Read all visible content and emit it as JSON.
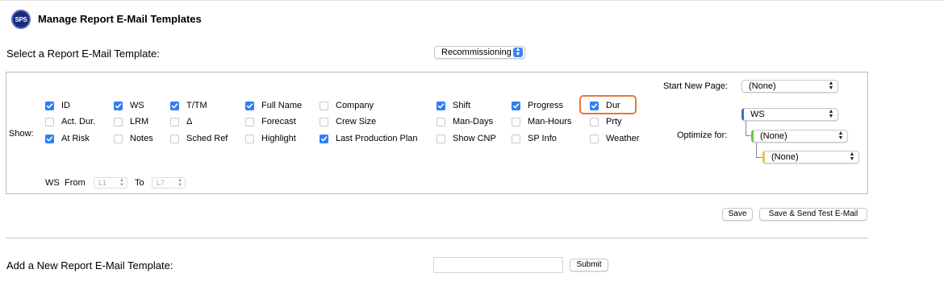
{
  "header": {
    "logo_text": "SPS",
    "title": "Manage Report E-Mail Templates"
  },
  "template_select": {
    "label": "Select a Report E-Mail Template:",
    "value": "Recommissioning"
  },
  "show": {
    "label": "Show:",
    "options": [
      [
        {
          "label": "ID",
          "checked": true
        },
        {
          "label": "Act. Dur.",
          "checked": false
        },
        {
          "label": "At Risk",
          "checked": true
        }
      ],
      [
        {
          "label": "WS",
          "checked": true
        },
        {
          "label": "LRM",
          "checked": false
        },
        {
          "label": "Notes",
          "checked": false
        }
      ],
      [
        {
          "label": "T/TM",
          "checked": true
        },
        {
          "label": "Δ",
          "checked": false
        },
        {
          "label": "Sched Ref",
          "checked": false
        }
      ],
      [
        {
          "label": "Full Name",
          "checked": true
        },
        {
          "label": "Forecast",
          "checked": false
        },
        {
          "label": "Highlight",
          "checked": false
        }
      ],
      [
        {
          "label": "Company",
          "checked": false
        },
        {
          "label": "Crew Size",
          "checked": false
        },
        {
          "label": "Last Production Plan",
          "checked": true
        }
      ],
      [
        {
          "label": "Shift",
          "checked": true
        },
        {
          "label": "Man-Days",
          "checked": false
        },
        {
          "label": "Show CNP",
          "checked": false
        }
      ],
      [
        {
          "label": "Progress",
          "checked": true
        },
        {
          "label": "Man-Hours",
          "checked": false
        },
        {
          "label": "SP Info",
          "checked": false
        }
      ],
      [
        {
          "label": "Dur",
          "checked": true
        },
        {
          "label": "Prty",
          "checked": false
        },
        {
          "label": "Weather",
          "checked": false
        }
      ]
    ]
  },
  "start_new_page": {
    "label": "Start New Page:",
    "value": "(None)"
  },
  "optimize": {
    "label": "Optimize for:",
    "level1": {
      "value": "WS",
      "color": "#3b6fd1"
    },
    "level2": {
      "value": "(None)",
      "color": "#6cc04a"
    },
    "level3": {
      "value": "(None)",
      "color": "#e6c34a"
    }
  },
  "ws_range": {
    "label": "WS",
    "from_label": "From",
    "from_value": "L1",
    "to_label": "To",
    "to_value": "L7"
  },
  "buttons": {
    "save": "Save",
    "save_send": "Save & Send Test E-Mail",
    "submit": "Submit"
  },
  "add_template": {
    "label": "Add a New Report E-Mail Template:",
    "input_value": ""
  },
  "colors": {
    "checkbox_on": "#2f7ff3",
    "highlight": "#e8763c",
    "popup_arrow": "#3b82f6"
  }
}
